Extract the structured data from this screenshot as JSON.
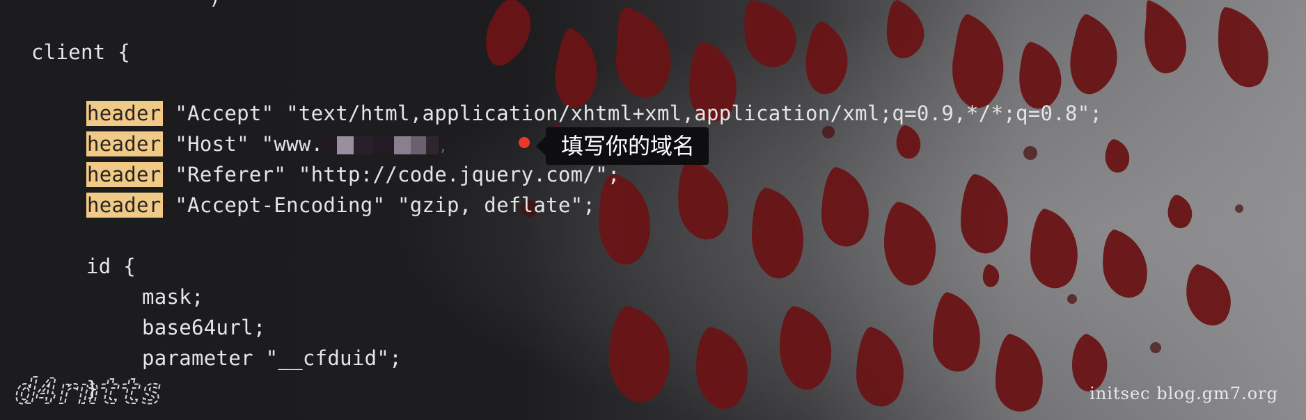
{
  "code": {
    "client_line": "client {",
    "header_keyword": "header",
    "accept_rest": " \"Accept\" \"text/html,application/xhtml+xml,application/xml;q=0.9,*/*;q=0.8\";",
    "host_rest_prefix": " \"Host\" \"www.",
    "host_rest_suffix": ",",
    "referer_rest": " \"Referer\" \"http://code.jquery.com/\";",
    "encoding_rest": " \"Accept-Encoding\" \"gzip, deflate\";",
    "id_line": "id {",
    "mask_line": "mask;",
    "base64url_line": "base64url;",
    "parameter_line": "parameter \"__cfduid\";",
    "close_line": "}"
  },
  "tooltip": {
    "text": "填写你的域名"
  },
  "watermark": {
    "text": "initsec blog.gm7.org"
  },
  "logo": {
    "text": "d4rntts"
  },
  "colors": {
    "highlight": "#f0ca86",
    "code_text": "#e6e6e6",
    "tooltip_bg": "#0e0e10",
    "tooltip_dot": "#e8372b",
    "background": "#1b1a1d",
    "splatter": "#6a1416"
  }
}
